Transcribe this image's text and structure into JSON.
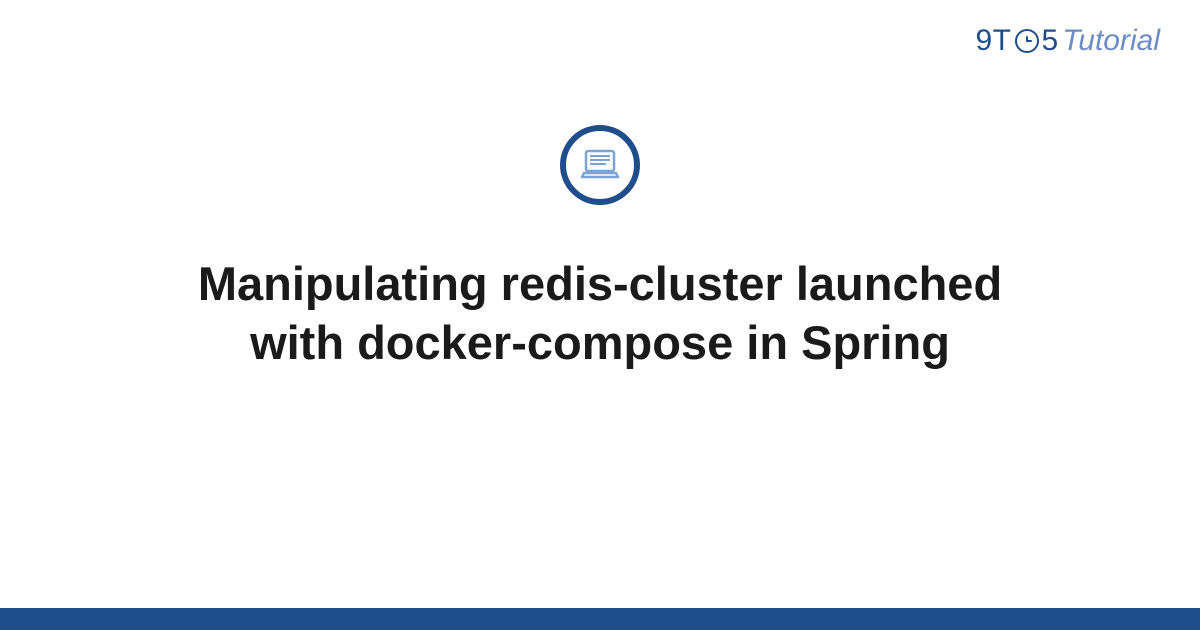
{
  "brand": {
    "part1": "9T",
    "part2": "5",
    "part3": "Tutorial"
  },
  "title": "Manipulating redis-cluster launched with docker-compose in Spring",
  "colors": {
    "primary": "#1f4e8c",
    "secondary": "#6b8cc4"
  }
}
